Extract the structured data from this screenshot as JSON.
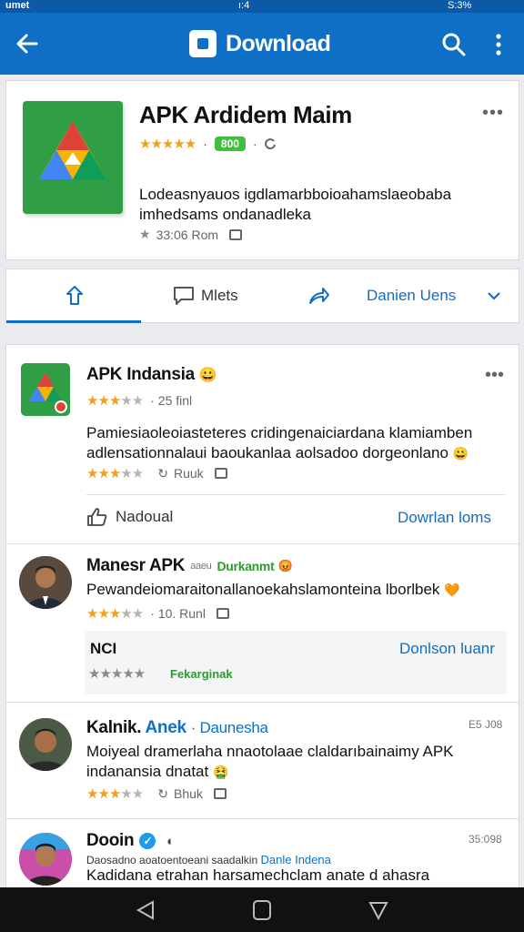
{
  "status_bar": {
    "left": "umet",
    "center": "ı:4",
    "right": "S:3%"
  },
  "app_bar": {
    "title": "Download",
    "icons": [
      "back-arrow-icon",
      "search-icon",
      "more-vert-icon"
    ]
  },
  "hero": {
    "app_name": "APK Ardidem Maim",
    "stars": "★★★★★",
    "badge": "800",
    "badge_color": "#3fbf3f",
    "description": "Lodeasnyauos igdlamarbboioahamslaeobaba imhedsams ondanadleka",
    "meta_text": "33:06 Rom"
  },
  "tabs": {
    "items": [
      {
        "label": ""
      },
      {
        "label": "Mlets"
      },
      {
        "label": ""
      },
      {
        "label": "Danien Uens"
      }
    ]
  },
  "feed": {
    "post1": {
      "name": "APK Indansia",
      "emoji": "😀",
      "stars": "★★★",
      "stars_off": "★★",
      "sub": "· 25 finl",
      "text": "Pamiesiaoleoiasteteres cridingenaiciardana klamiamben adlensationnalaui baoukanlaa aolsadoo dorgeonlano",
      "emoji2": "😀",
      "meta_text": "Ruuk",
      "action_left": "Nadoual",
      "action_right": "Dowrlan loms"
    },
    "post2": {
      "name": "Manesr APK",
      "prefix": "aaeu",
      "tag": "Durkanmt",
      "tag_emoji": "😡",
      "text": "Pewandeiomaraitonallanoekahslamonteina lborlbek",
      "emoji": "🧡",
      "meta_text": "10. Runl",
      "reply_label": "NCI",
      "reply_link": "Donlson luanr",
      "reply_tag": "Fekarginak"
    },
    "post3": {
      "name_a": "Kalnik.",
      "name_b": "Anek",
      "name_c": "· Daunesha",
      "time": "E5 J08",
      "text": "Moiyeal dramerlaha nnaotolaae claldarıbainaimy APK indanansia dnatat",
      "emoji": "🤮",
      "meta_text": "Bhuk"
    },
    "post4": {
      "name": "Dooin",
      "time": "35:098",
      "sub": "Daosadno aoatoentoeani saadalkin",
      "sub_link": "Danle Indena",
      "text": "Kadidana etrahan harsamechclam anate d ahasra"
    }
  },
  "colors": {
    "primary": "#0f6fc6",
    "accent_green": "#2f9e45",
    "star": "#f0a020"
  }
}
